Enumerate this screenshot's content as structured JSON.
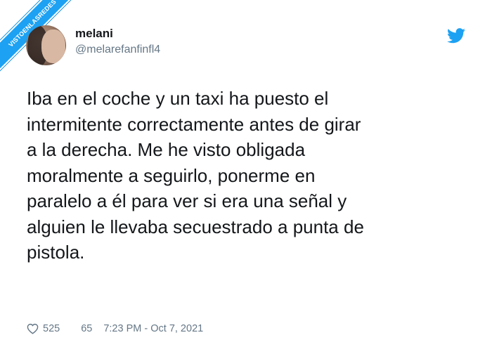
{
  "watermark": {
    "text": "VISTOENLASREDES"
  },
  "tweet": {
    "author_name": "melani",
    "author_handle": "@melarefanfinfl4",
    "text": "Iba en el coche y un taxi ha puesto el\nintermitente correctamente antes de girar\na la derecha. Me he visto obligada\nmoralmente a seguirlo, ponerme en\nparalelo a él para ver si era una señal y\nalguien le llevaba secuestrado a punta de\npistola.",
    "likes": "525",
    "replies": "65",
    "timestamp": "7:23 PM - Oct 7, 2021"
  },
  "colors": {
    "brand": "#1da1f2",
    "text": "#14171a",
    "muted": "#657786"
  },
  "icons": {
    "logo": "twitter-bird-icon",
    "like": "heart-icon"
  }
}
